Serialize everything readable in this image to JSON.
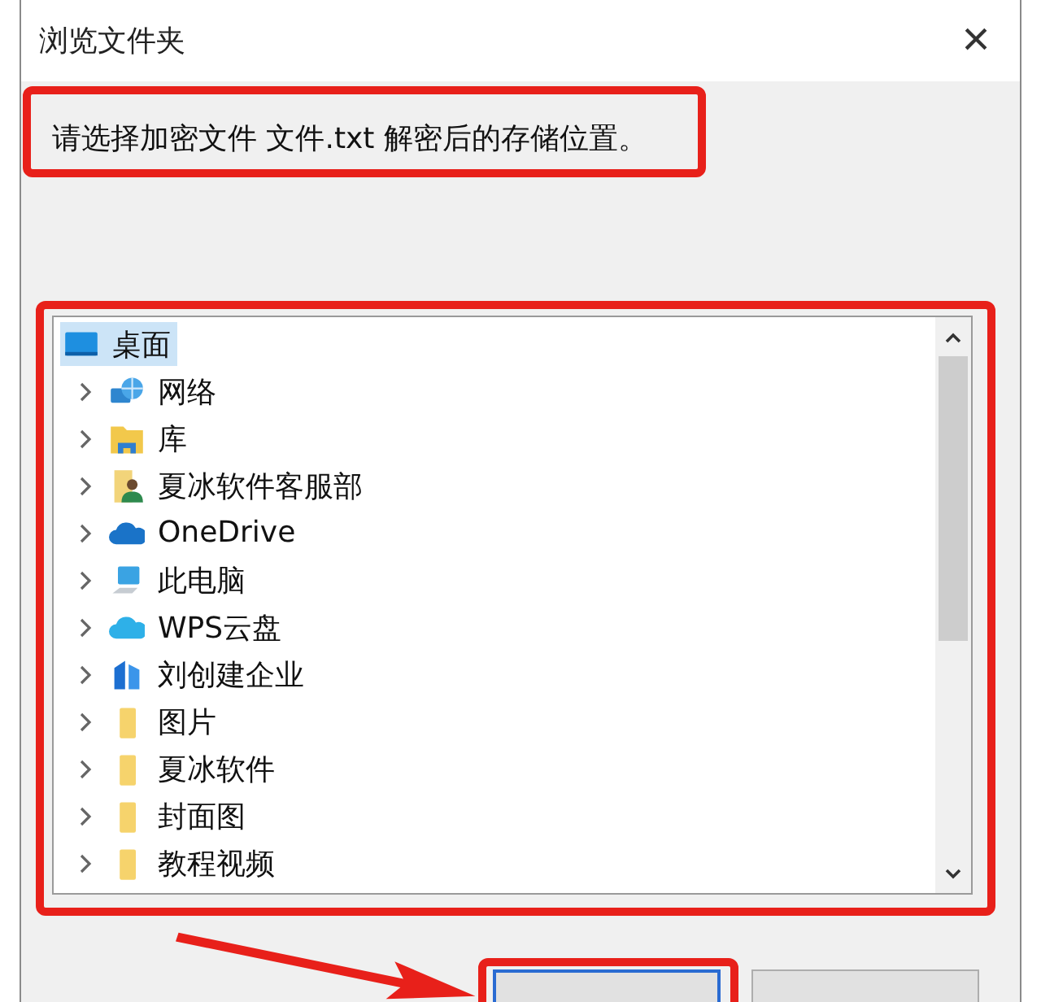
{
  "window": {
    "title": "浏览文件夹",
    "close_glyph": "×"
  },
  "message": "请选择加密文件 文件.txt 解密后的存储位置。",
  "tree": {
    "root": {
      "label": "桌面",
      "kind": "desktop",
      "selected": true
    },
    "children": [
      {
        "label": "网络",
        "kind": "network",
        "expandable": true
      },
      {
        "label": "库",
        "kind": "library",
        "expandable": true
      },
      {
        "label": "夏冰软件客服部",
        "kind": "user",
        "expandable": true
      },
      {
        "label": "OneDrive",
        "kind": "cloud",
        "expandable": true
      },
      {
        "label": "此电脑",
        "kind": "computer",
        "expandable": true
      },
      {
        "label": "WPS云盘",
        "kind": "wps",
        "expandable": true
      },
      {
        "label": "刘创建企业",
        "kind": "enterprise",
        "expandable": true
      },
      {
        "label": "图片",
        "kind": "folder",
        "expandable": true
      },
      {
        "label": "夏冰软件",
        "kind": "folder",
        "expandable": true
      },
      {
        "label": "封面图",
        "kind": "folder",
        "expandable": true
      },
      {
        "label": "教程视频",
        "kind": "folder",
        "expandable": true
      }
    ]
  }
}
